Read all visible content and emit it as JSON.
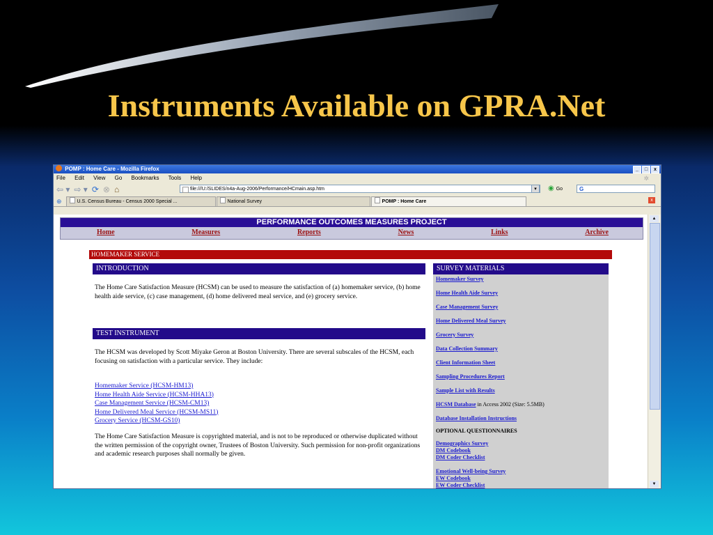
{
  "slide": {
    "title": "Instruments Available on GPRA.Net"
  },
  "browser": {
    "window_title": "POMP : Home Care - Mozilla Firefox",
    "window_buttons": [
      "_",
      "□",
      "x"
    ],
    "menu": [
      "File",
      "Edit",
      "View",
      "Go",
      "Bookmarks",
      "Tools",
      "Help"
    ],
    "url": "file:///U:/SLIDES/n4a-Aug-2006/Performance/HCmain.asp.htm",
    "go_label": "Go",
    "search_value": "G",
    "tabs": [
      {
        "label": "U.S. Census Bureau - Census 2000 Special ...",
        "active": false
      },
      {
        "label": "National Survey",
        "active": false
      },
      {
        "label": "POMP : Home Care",
        "active": true
      }
    ]
  },
  "page": {
    "header_title": "PERFORMANCE OUTCOMES MEASURES PROJECT",
    "nav": [
      "Home",
      "Measures",
      "Reports",
      "News",
      "Links",
      "Archive"
    ],
    "section_bar": "HOMEMAKER SERVICE",
    "intro": {
      "heading": "INTRODUCTION",
      "text": "The Home Care Satisfaction Measure (HCSM) can be used to measure the satisfaction of (a) homemaker service, (b) home health aide service, (c) case management, (d) home delivered meal service, and (e) grocery service."
    },
    "test": {
      "heading": "TEST INSTRUMENT",
      "text": "The HCSM was developed by Scott Miyake Geron at Boston University. There are several subscales of the HCSM, each focusing on satisfaction with a particular service. They include:",
      "instruments": [
        "Homemaker Service (HCSM-HM13)",
        "Home Health Aide Service (HCSM-HHA13)",
        "Case Management Service (HCSM-CM13)",
        "Home Delivered Meal Service (HCSM-MS11)",
        "Grocery Service (HCSM-GS10)"
      ],
      "copyright": "The Home Care Satisfaction Measure is copyrighted material, and is not to be reproduced or otherwise duplicated without the written permission of the copyright owner, Trustees of Boston University. Such permission for non-profit organizations and academic research purposes shall normally be given."
    },
    "survey": {
      "heading": "SURVEY MATERIALS",
      "links": [
        "Homemaker Survey",
        "Home Health Aide Survey",
        "Case Management Survey",
        "Home Delivered Meal Survey",
        "Grocery Survey",
        "Data Collection Summary",
        "Client Information Sheet",
        "Sampling Procedures Report",
        "Sample List with Results"
      ],
      "database_link": "HCSM Database",
      "database_note": " in Access 2002 (Size: 5.5MB)",
      "install_link": "Database Installation Instructions",
      "optional_heading": "OPTIONAL QUESTIONNAIRES",
      "optional_links_1": [
        "Demographics Survey",
        "DM Codebook",
        "DM Coder Checklist"
      ],
      "optional_links_2": [
        "Emotional Well-being Survey",
        "EW Codebook",
        "EW Coder Checklist"
      ]
    }
  }
}
